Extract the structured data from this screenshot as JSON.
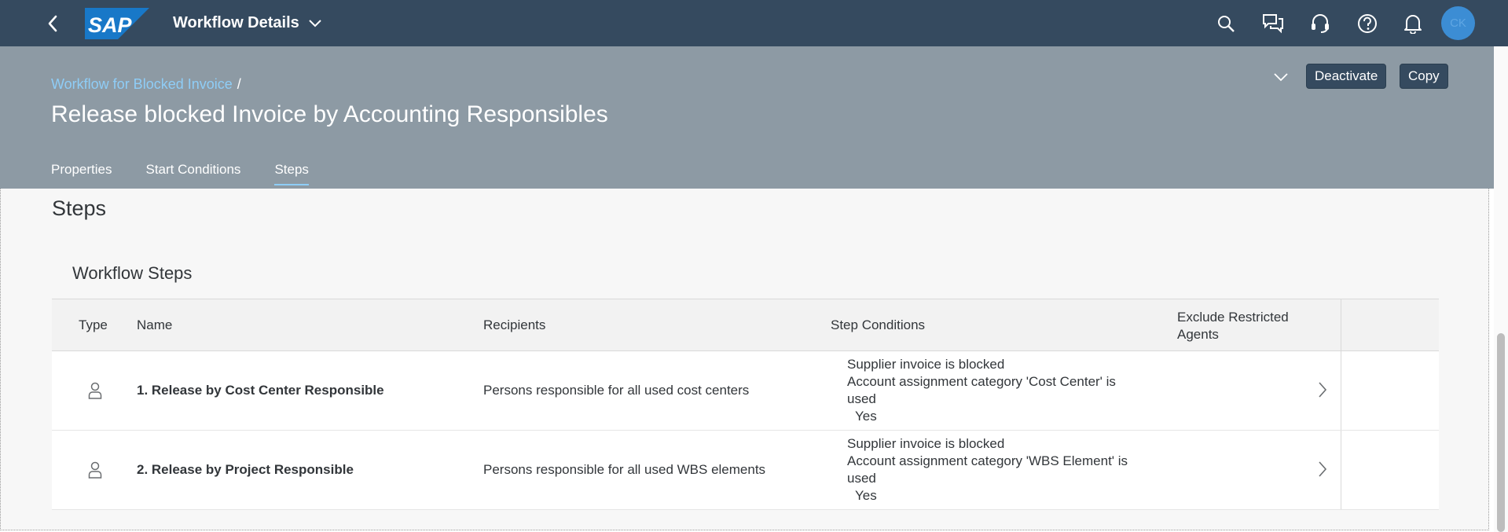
{
  "shell": {
    "app_title": "Workflow Details",
    "logo_text": "SAP",
    "avatar_initials": "CK",
    "icons": [
      "back-icon",
      "search-icon",
      "chat-icon",
      "headset-icon",
      "help-icon",
      "bell-icon"
    ],
    "colors": {
      "shell_bg": "#354a5f",
      "header_bg": "#8d9aa4",
      "avatar": "#3c8dd4",
      "logo": "#1878c8",
      "link": "#8ecdf7"
    }
  },
  "header": {
    "breadcrumb_link": "Workflow for Blocked Invoice",
    "breadcrumb_sep": "/",
    "title": "Release blocked Invoice by Accounting Responsibles",
    "deactivate_label": "Deactivate",
    "copy_label": "Copy",
    "tabs": [
      {
        "label": "Properties"
      },
      {
        "label": "Start Conditions"
      },
      {
        "label": "Steps",
        "active": true
      }
    ]
  },
  "section": {
    "title": "Steps",
    "panel_title": "Workflow Steps",
    "columns": {
      "type": "Type",
      "name": "Name",
      "recipients": "Recipients",
      "step_conditions": "Step Conditions",
      "exclude_line1": "Exclude Restricted",
      "exclude_line2": "Agents"
    },
    "rows": [
      {
        "type_icon": "person-icon",
        "name": "1. Release by Cost Center Responsible",
        "recipients": "Persons responsible for all used cost centers",
        "cond1": "Supplier invoice is blocked",
        "cond2": "Account assignment category 'Cost Center' is",
        "cond3": "used",
        "cond4": "Yes"
      },
      {
        "type_icon": "person-icon",
        "name": "2. Release by Project Responsible",
        "recipients": "Persons responsible for all used WBS elements",
        "cond1": "Supplier invoice is blocked",
        "cond2": "Account assignment category 'WBS Element' is",
        "cond3": "used",
        "cond4": "Yes"
      }
    ]
  }
}
